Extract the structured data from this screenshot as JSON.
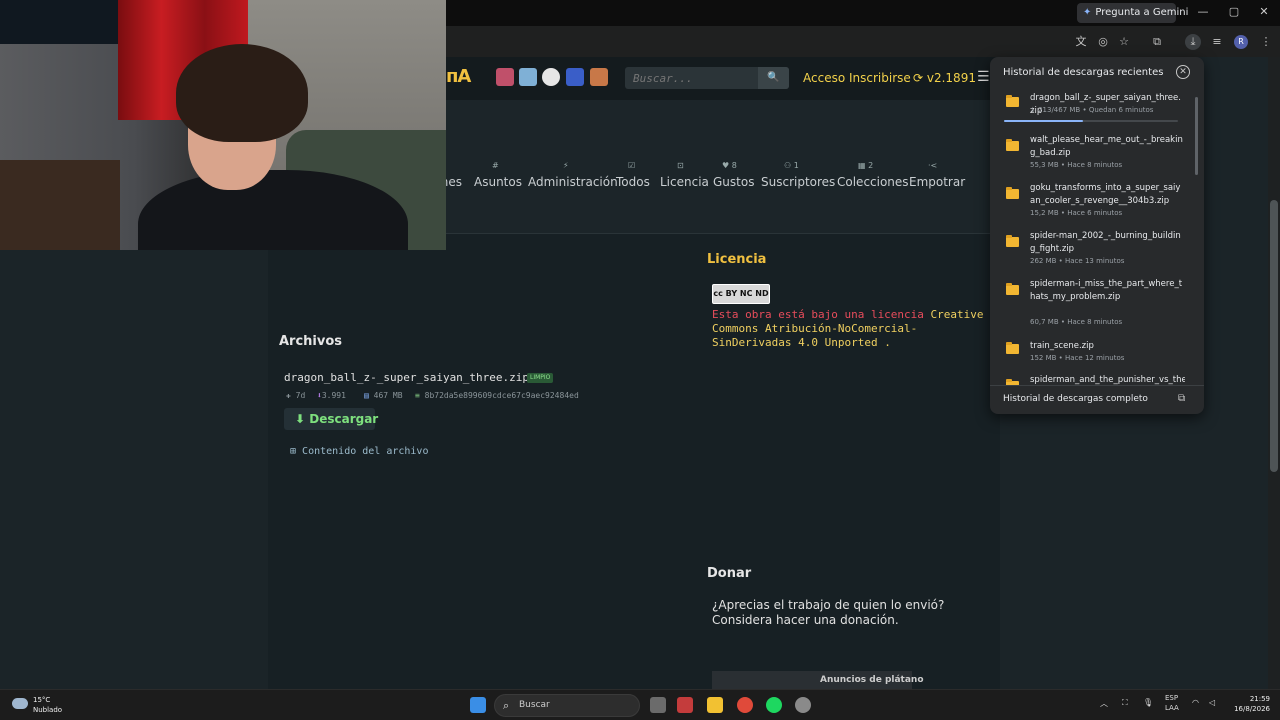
{
  "browser": {
    "gemini_button": "Pregunta a Gemini",
    "window_controls": {
      "minimize": "—",
      "maximize": "▢",
      "close": "✕"
    },
    "avatar_letter": "R"
  },
  "site": {
    "logo": "ᴨA",
    "search_placeholder": "Buscar...",
    "nav": {
      "login": "Acceso",
      "signup": "Inscribirse",
      "version": "v2.1891"
    },
    "tabs": [
      {
        "icon": "",
        "label": "nes"
      },
      {
        "icon": "#",
        "label": "Asuntos"
      },
      {
        "icon": "⚡",
        "label": "Administración"
      },
      {
        "icon": "☑",
        "label": "Todos"
      },
      {
        "icon": "⊡",
        "label": "Licencia"
      },
      {
        "icon": "♥ 8",
        "label": "Gustos"
      },
      {
        "icon": "⚇ 1",
        "label": "Suscriptores"
      },
      {
        "icon": "▦ 2",
        "label": "Colecciones"
      },
      {
        "icon": "·<",
        "label": "Empotrar"
      }
    ]
  },
  "license": {
    "title": "Licencia",
    "badge": "cc BY NC ND",
    "text_prefix": "Esta obra está bajo una licencia",
    "text_link": "Creative Commons Atribución-NoComercial-SinDerivadas 4.0 Unported",
    "text_suffix": "."
  },
  "files": {
    "title": "Archivos",
    "file_name": "dragon_ball_z-_super_saiyan_three.zip",
    "clean_badge": "LIMPIO",
    "age": "7d",
    "downloads": "3.991",
    "size": "467 MB",
    "hash": "8b72da5e899609cdce67c9aec92484ed",
    "download_button": "Descargar",
    "contents_link": "Contenido del archivo"
  },
  "donate": {
    "title": "Donar",
    "text": "¿Aprecias el trabajo de quien lo envió? Considera hacer una donación.",
    "ads_label": "Anuncios de plátano"
  },
  "downloads_panel": {
    "title": "Historial de descargas recientes",
    "items": [
      {
        "name": "dragon_ball_z-_super_saiyan_three.zip",
        "status": "↓ 213/467 MB • Quedan 6 minutos",
        "progress": 0.456
      },
      {
        "name": "walt_please_hear_me_out_-_breaking_bad.zip",
        "status": "55,3 MB • Hace 8 minutos"
      },
      {
        "name": "goku_transforms_into_a_super_saiyan_cooler_s_revenge__304b3.zip",
        "status": "15,2 MB • Hace 6 minutos"
      },
      {
        "name": "spider-man_2002_-_burning_building_fight.zip",
        "status": "262 MB • Hace 13 minutos"
      },
      {
        "name": "spiderman-i_miss_the_part_where_thats_my_problem.zip",
        "status": "60,7 MB • Hace 8 minutos"
      },
      {
        "name": "train_scene.zip",
        "status": "152 MB • Hace 12 minutos"
      },
      {
        "name": "spiderman_and_the_punisher_vs_the_",
        "status": ""
      }
    ],
    "full_history": "Historial de descargas completo"
  },
  "taskbar": {
    "weather_temp": "15°C",
    "weather_desc": "Nublado",
    "search_label": "Buscar",
    "lang_top": "ESP",
    "lang_bottom": "LAA",
    "time": "21:59",
    "date": "16/8/2026"
  }
}
